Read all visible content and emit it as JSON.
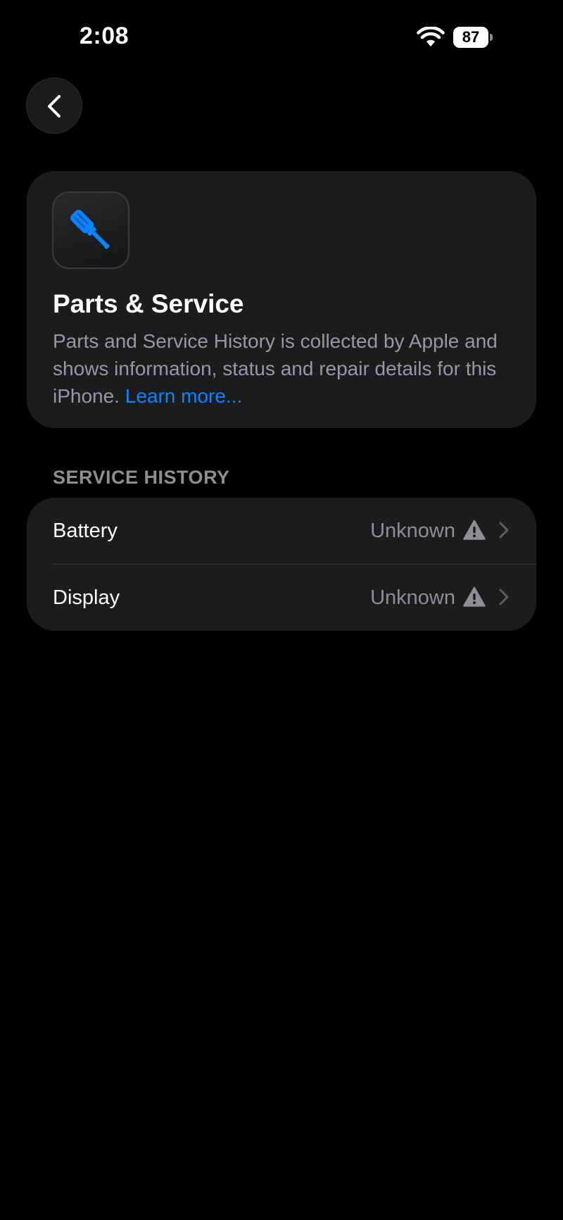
{
  "status_bar": {
    "time": "2:08",
    "battery_percent": "87",
    "wifi_icon": "wifi-icon"
  },
  "nav": {
    "back_icon": "chevron-left-icon"
  },
  "header_card": {
    "icon": "screwdriver-icon",
    "icon_color": "#0a84ff",
    "title": "Parts & Service",
    "description": "Parts and Service History is collected by Apple and shows information, status and repair details for this iPhone. ",
    "link_label": "Learn more..."
  },
  "service_history": {
    "section_title": "SERVICE HISTORY",
    "rows": [
      {
        "label": "Battery",
        "value": "Unknown",
        "status_icon": "warning-icon"
      },
      {
        "label": "Display",
        "value": "Unknown",
        "status_icon": "warning-icon"
      }
    ]
  },
  "colors": {
    "background": "#000000",
    "card": "#1c1c1e",
    "link": "#0a84ff",
    "secondary_text": "#8e8e93"
  }
}
